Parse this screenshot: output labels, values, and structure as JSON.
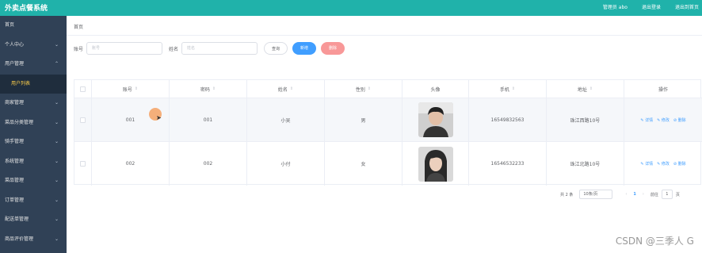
{
  "app": {
    "title": "外卖点餐系统"
  },
  "topnav": {
    "admin": "管理员 abo",
    "logout": "退出登录",
    "home": "退出到首页"
  },
  "sidebar": {
    "items": [
      {
        "label": "首页",
        "arrow": ""
      },
      {
        "label": "个人中心",
        "arrow": "⌄"
      },
      {
        "label": "用户管理",
        "arrow": "⌃"
      },
      {
        "label": "商家管理",
        "arrow": "⌄"
      },
      {
        "label": "菜品分类管理",
        "arrow": "⌄"
      },
      {
        "label": "骑手管理",
        "arrow": "⌄"
      },
      {
        "label": "系统管理",
        "arrow": "⌄"
      },
      {
        "label": "菜品管理",
        "arrow": "⌄"
      },
      {
        "label": "订单管理",
        "arrow": "⌄"
      },
      {
        "label": "配送单管理",
        "arrow": "⌄"
      },
      {
        "label": "商品评价管理",
        "arrow": "⌄"
      }
    ],
    "sub": "用户列表"
  },
  "breadcrumb": "首页",
  "search": {
    "account_label": "账号",
    "account_placeholder": "账号",
    "name_label": "姓名",
    "name_placeholder": "姓名",
    "query": "查询",
    "add": "新增",
    "delete": "删除"
  },
  "table": {
    "headers": [
      "账号",
      "密码",
      "姓名",
      "性别",
      "头像",
      "手机",
      "地址",
      "操作"
    ],
    "rows": [
      {
        "account": "001",
        "password": "001",
        "name": "小吴",
        "gender": "男",
        "phone": "16549832563",
        "address": "珠江西路10号"
      },
      {
        "account": "002",
        "password": "002",
        "name": "小付",
        "gender": "女",
        "phone": "16546532233",
        "address": "珠江北路10号"
      }
    ],
    "ops": {
      "detail": "✎ 详情",
      "edit": "✎ 修改",
      "delete": "⊘ 删除"
    }
  },
  "pager": {
    "total": "共 2 条",
    "size": "10条/页",
    "prev": "‹",
    "page": "1",
    "next": "›",
    "goto": "前往",
    "go_value": "1",
    "page_unit": "页"
  },
  "colors": {
    "topbar": "#20b2aa",
    "sidebar": "#304156",
    "accent": "#409eff",
    "danger": "#f89898",
    "active_sub": "#ffd04b"
  },
  "icons": {
    "sort": "sort-caret-icon",
    "chevron": "chevron-icon"
  },
  "watermark": "CSDN @三季人 G"
}
